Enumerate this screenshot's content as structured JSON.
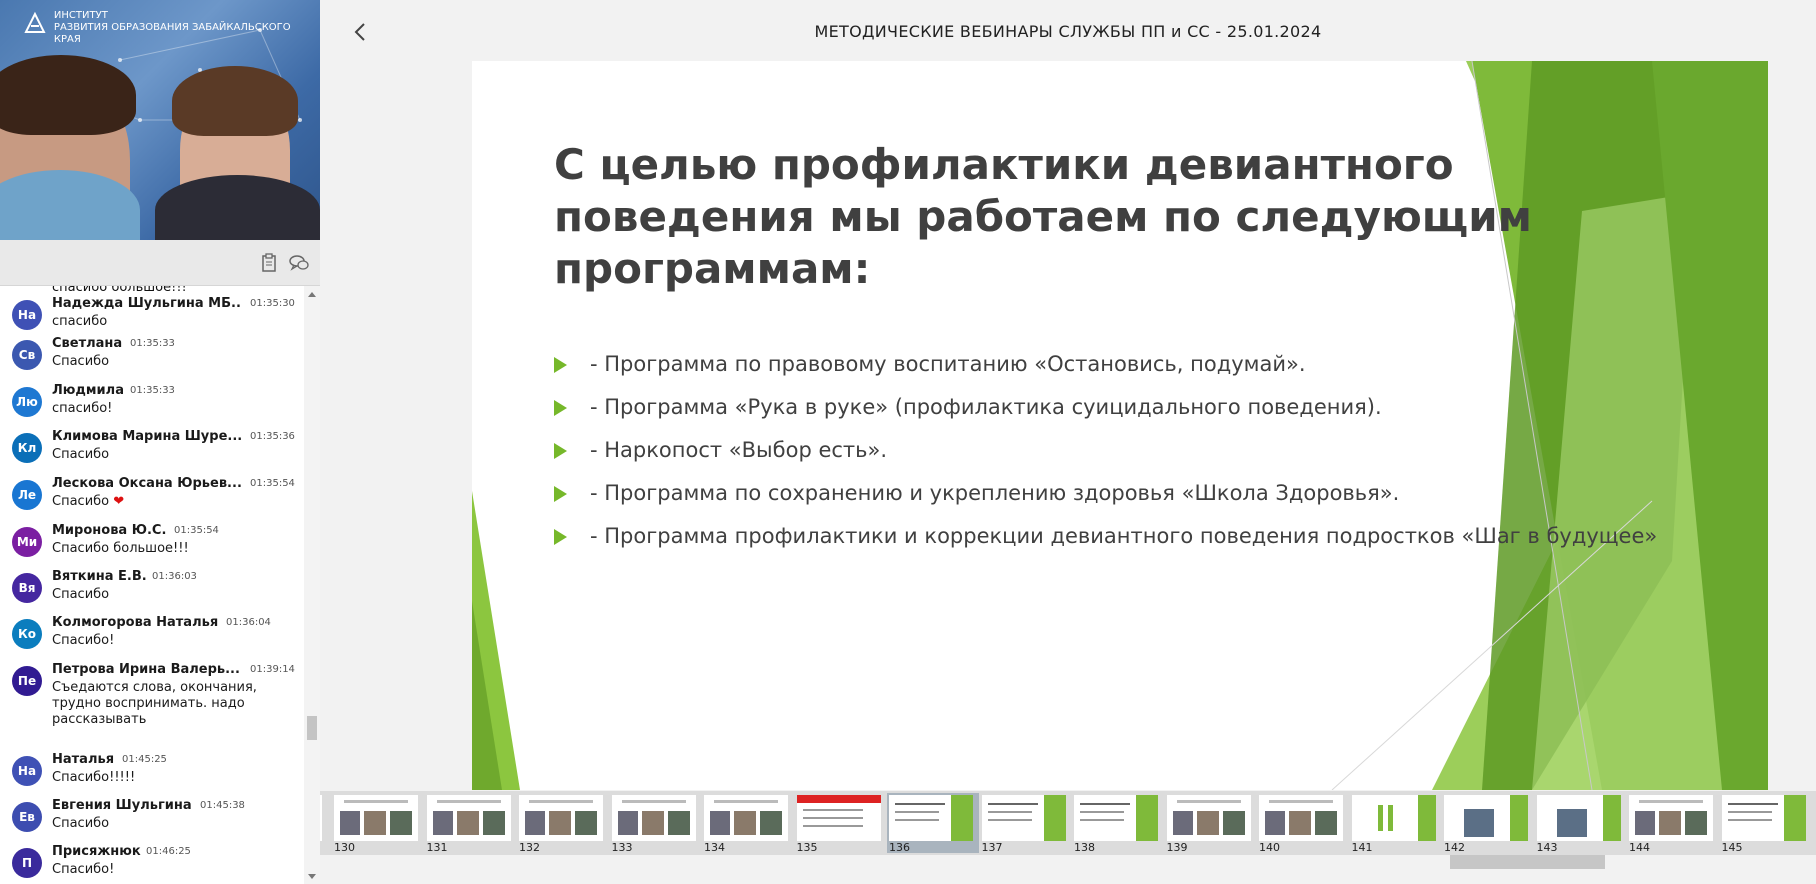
{
  "video": {
    "org_line1": "ИНСТИТУТ",
    "org_line2": "РАЗВИТИЯ ОБРАЗОВАНИЯ ЗАБАЙКАЛЬСКОГО КРАЯ"
  },
  "chat": {
    "partial_text": "спасибо большое!!!",
    "messages": [
      {
        "initials": "На",
        "color": "#3f51b5",
        "name": "Надежда Шульгина МБ...",
        "time": "01:35:30",
        "text": "спасибо"
      },
      {
        "initials": "Св",
        "color": "#3b58b0",
        "name": "Светлана",
        "time": "01:35:33",
        "text": "Спасибо"
      },
      {
        "initials": "Лю",
        "color": "#1e78d2",
        "name": "Людмила",
        "time": "01:35:33",
        "text": "спасибо!"
      },
      {
        "initials": "Кл",
        "color": "#0b6fb8",
        "name": "Климова Марина Шуре...",
        "time": "01:35:36",
        "text": "Спасибо"
      },
      {
        "initials": "Ле",
        "color": "#1976d2",
        "name": "Лескова Оксана Юрьев...",
        "time": "01:35:54",
        "text": "Спасибо",
        "heart": "❤"
      },
      {
        "initials": "Ми",
        "color": "#7b1fa2",
        "name": "Миронова Ю.С.",
        "time": "01:35:54",
        "text": "Спасибо большое!!!"
      },
      {
        "initials": "Вя",
        "color": "#4527a0",
        "name": "Вяткина Е.В.",
        "time": "01:36:03",
        "text": "Спасибо"
      },
      {
        "initials": "Ко",
        "color": "#0b7dbe",
        "name": "Колмогорова Наталья",
        "time": "01:36:04",
        "text": "Спасибо!"
      },
      {
        "initials": "Пе",
        "color": "#311b92",
        "name": "Петрова Ирина Валерь...",
        "time": "01:39:14",
        "text": "Съедаются слова, окончания, трудно воспринимать. надо рассказывать"
      },
      {
        "initials": "На",
        "color": "#3f51b5",
        "name": "Наталья",
        "time": "01:45:25",
        "text": "Спасибо!!!!!"
      },
      {
        "initials": "Ев",
        "color": "#3d4db0",
        "name": "Евгения Шульгина",
        "time": "01:45:38",
        "text": "Спасибо"
      },
      {
        "initials": "П",
        "color": "#3a2a9c",
        "name": "Присяжнюк",
        "time": "01:46:25",
        "text": "Спасибо!"
      }
    ]
  },
  "header": {
    "title": "МЕТОДИЧЕСКИЕ ВЕБИНАРЫ СЛУЖБЫ ПП и СС - 25.01.2024"
  },
  "slide": {
    "heading": "С целью профилактики девиантного поведения мы работаем по следующим программам:",
    "bullets": [
      "- Программа по правовому воспитанию «Остановись, подумай».",
      "- Программа «Рука в руке» (профилактика суицидального поведения).",
      "- Наркопост «Выбор есть».",
      "- Программа по сохранению и укреплению здоровья «Школа Здоровья».",
      "- Программа профилактики и коррекции девиантного поведения подростков «Шаг в будущее»"
    ],
    "accent_color": "#76b82a"
  },
  "filmstrip": {
    "active": "136",
    "items": [
      "130",
      "131",
      "132",
      "133",
      "134",
      "135",
      "136",
      "137",
      "138",
      "139",
      "140",
      "141",
      "142",
      "143",
      "144",
      "145"
    ]
  }
}
